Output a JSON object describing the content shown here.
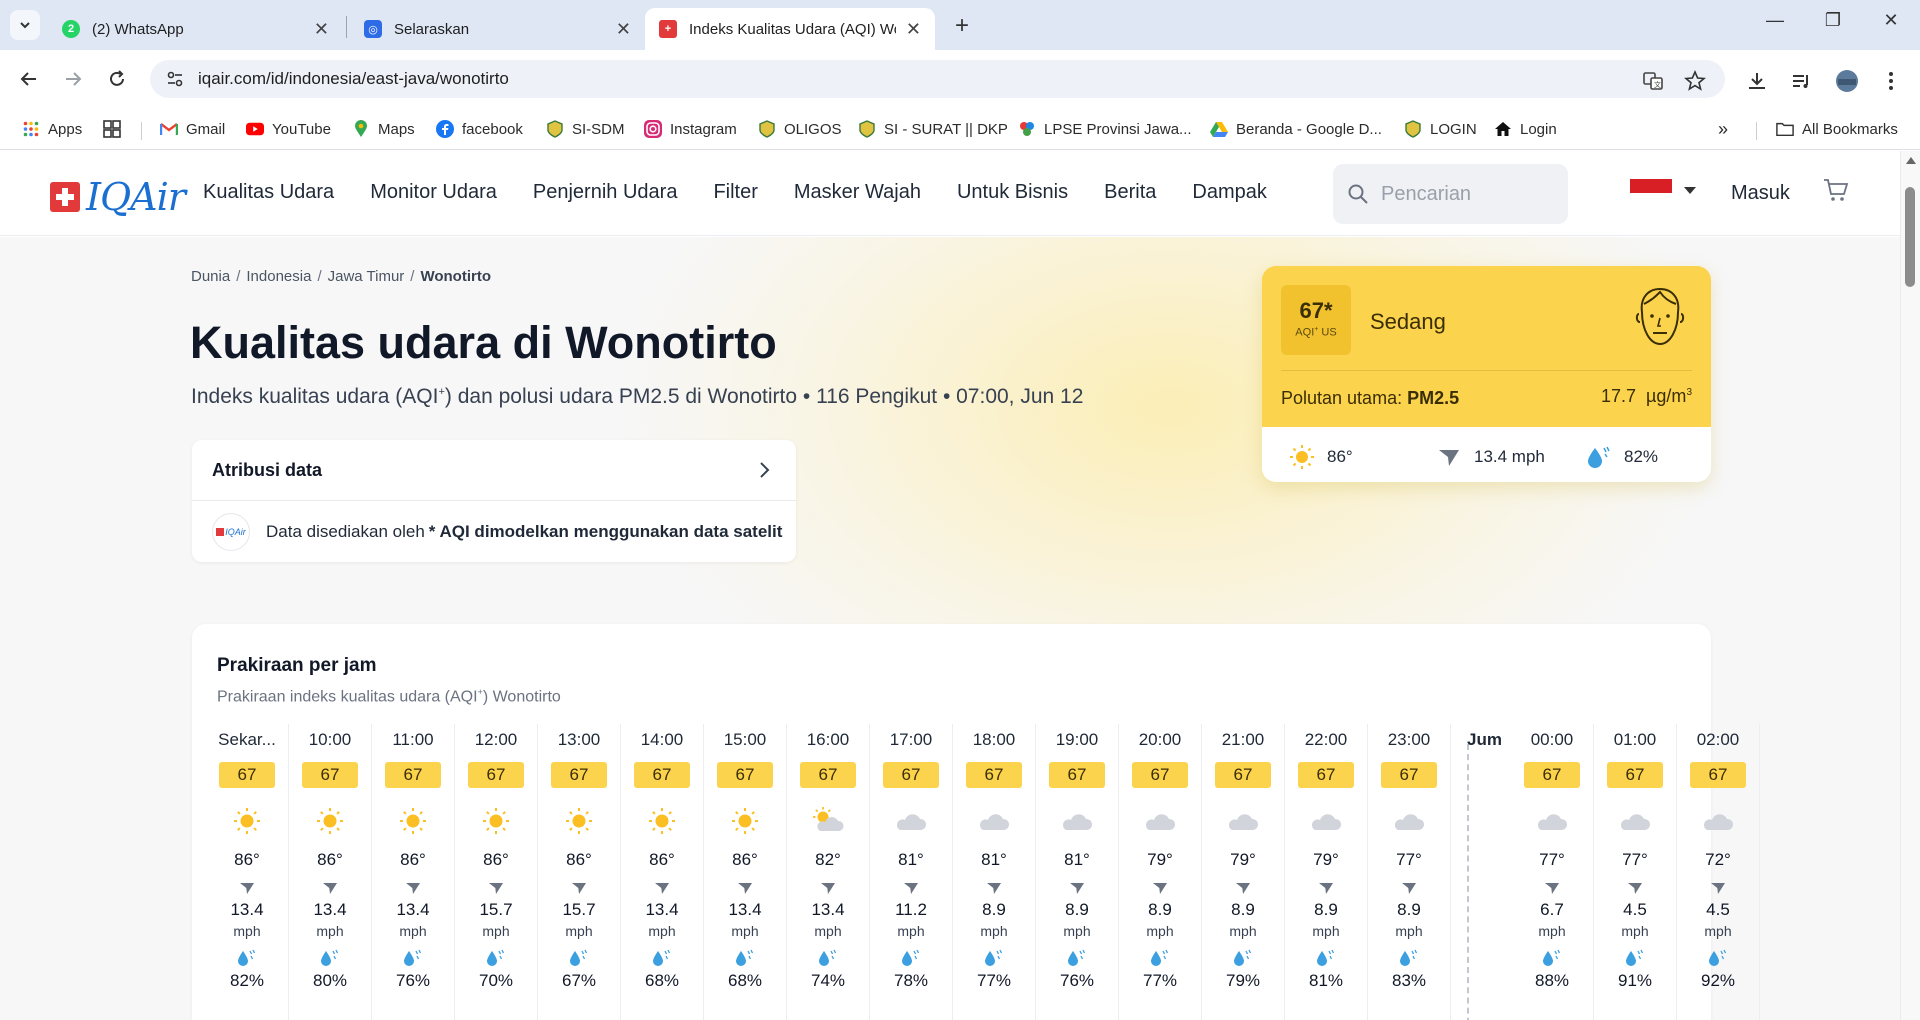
{
  "browser": {
    "tabs": [
      {
        "label": "(2) WhatsApp",
        "icon": "whatsapp-icon",
        "color": "#25d366"
      },
      {
        "label": "Selaraskan",
        "icon": "selaraskan-icon",
        "color": "#2e6be6"
      },
      {
        "label": "Indeks Kualitas Udara (AQI) Wo",
        "icon": "iqair-icon",
        "color": "#e23a3a"
      }
    ],
    "url": "iqair.com/id/indonesia/east-java/wonotirto",
    "bookmarks": [
      {
        "label": "Apps",
        "icon": "apps-grid-icon"
      },
      {
        "label": "",
        "icon": "tab-groups-icon"
      },
      {
        "label": "Gmail",
        "icon": "gmail-icon"
      },
      {
        "label": "YouTube",
        "icon": "youtube-icon"
      },
      {
        "label": "Maps",
        "icon": "maps-icon"
      },
      {
        "label": "facebook",
        "icon": "facebook-icon"
      },
      {
        "label": "SI-SDM",
        "icon": "emblem-icon"
      },
      {
        "label": "Instagram",
        "icon": "instagram-icon"
      },
      {
        "label": "OLIGOS",
        "icon": "emblem-icon"
      },
      {
        "label": "SI - SURAT || DKP",
        "icon": "emblem-icon"
      },
      {
        "label": "LPSE Provinsi Jawa...",
        "icon": "lpse-icon"
      },
      {
        "label": "Beranda - Google D...",
        "icon": "google-drive-icon"
      },
      {
        "label": "LOGIN",
        "icon": "emblem-icon"
      },
      {
        "label": "Login",
        "icon": "home-icon"
      }
    ],
    "all_bookmarks": "All Bookmarks"
  },
  "site": {
    "logo_text": "IQAir",
    "nav": [
      "Kualitas Udara",
      "Monitor Udara",
      "Penjernih Udara",
      "Filter",
      "Masker Wajah",
      "Untuk Bisnis",
      "Berita",
      "Dampak"
    ],
    "search_placeholder": "Pencarian",
    "login": "Masuk"
  },
  "breadcrumb": [
    "Dunia",
    "Indonesia",
    "Jawa Timur",
    "Wonotirto"
  ],
  "title": "Kualitas udara di Wonotirto",
  "subtitle": {
    "pre": "Indeks kualitas udara (AQI",
    "sup": "+",
    "post": ") dan polusi udara PM2.5 di Wonotirto • 116 Pengikut • 07:00, Jun 12"
  },
  "attribution": {
    "heading": "Atribusi data",
    "logo_text": "IQAir",
    "provided_by": "Data disediakan oleh",
    "note": "* AQI dimodelkan menggunakan data satelit"
  },
  "aqi_card": {
    "value": "67*",
    "unit_pre": "AQI",
    "unit_sup": "+",
    "unit_post": " US",
    "level": "Sedang",
    "pollutant_label": "Polutan utama:",
    "pollutant": "PM2.5",
    "concentration": "17.7",
    "conc_unit": "µg/m",
    "conc_sup": "3",
    "temp": "86°",
    "wind": "13.4 mph",
    "humidity": "82%",
    "bg_color": "#fcd34d"
  },
  "forecast": {
    "title": "Prakiraan per jam",
    "sub_pre": "Prakiraan indeks kualitas udara (AQI",
    "sub_sup": "+",
    "sub_post": ") Wonotirto",
    "day_label": "Jum",
    "unit": "mph",
    "hours": [
      {
        "time": "Sekar...",
        "aqi": "67",
        "icon": "sun",
        "temp": "86°",
        "wind": "13.4",
        "hum": "82%"
      },
      {
        "time": "10:00",
        "aqi": "67",
        "icon": "sun",
        "temp": "86°",
        "wind": "13.4",
        "hum": "80%"
      },
      {
        "time": "11:00",
        "aqi": "67",
        "icon": "sun",
        "temp": "86°",
        "wind": "13.4",
        "hum": "76%"
      },
      {
        "time": "12:00",
        "aqi": "67",
        "icon": "sun",
        "temp": "86°",
        "wind": "15.7",
        "hum": "70%"
      },
      {
        "time": "13:00",
        "aqi": "67",
        "icon": "sun",
        "temp": "86°",
        "wind": "15.7",
        "hum": "67%"
      },
      {
        "time": "14:00",
        "aqi": "67",
        "icon": "sun",
        "temp": "86°",
        "wind": "13.4",
        "hum": "68%"
      },
      {
        "time": "15:00",
        "aqi": "67",
        "icon": "sun",
        "temp": "86°",
        "wind": "13.4",
        "hum": "68%"
      },
      {
        "time": "16:00",
        "aqi": "67",
        "icon": "partly",
        "temp": "82°",
        "wind": "13.4",
        "hum": "74%"
      },
      {
        "time": "17:00",
        "aqi": "67",
        "icon": "cloud",
        "temp": "81°",
        "wind": "11.2",
        "hum": "78%"
      },
      {
        "time": "18:00",
        "aqi": "67",
        "icon": "cloud",
        "temp": "81°",
        "wind": "8.9",
        "hum": "77%"
      },
      {
        "time": "19:00",
        "aqi": "67",
        "icon": "cloud",
        "temp": "81°",
        "wind": "8.9",
        "hum": "76%"
      },
      {
        "time": "20:00",
        "aqi": "67",
        "icon": "cloud",
        "temp": "79°",
        "wind": "8.9",
        "hum": "77%"
      },
      {
        "time": "21:00",
        "aqi": "67",
        "icon": "cloud",
        "temp": "79°",
        "wind": "8.9",
        "hum": "79%"
      },
      {
        "time": "22:00",
        "aqi": "67",
        "icon": "cloud",
        "temp": "79°",
        "wind": "8.9",
        "hum": "81%"
      },
      {
        "time": "23:00",
        "aqi": "67",
        "icon": "cloud",
        "temp": "77°",
        "wind": "8.9",
        "hum": "83%"
      },
      {
        "time": "00:00",
        "aqi": "67",
        "icon": "cloud",
        "temp": "77°",
        "wind": "6.7",
        "hum": "88%"
      },
      {
        "time": "01:00",
        "aqi": "67",
        "icon": "cloud",
        "temp": "77°",
        "wind": "4.5",
        "hum": "91%"
      },
      {
        "time": "02:00",
        "aqi": "67",
        "icon": "cloud",
        "temp": "72°",
        "wind": "4.5",
        "hum": "92%"
      }
    ]
  }
}
